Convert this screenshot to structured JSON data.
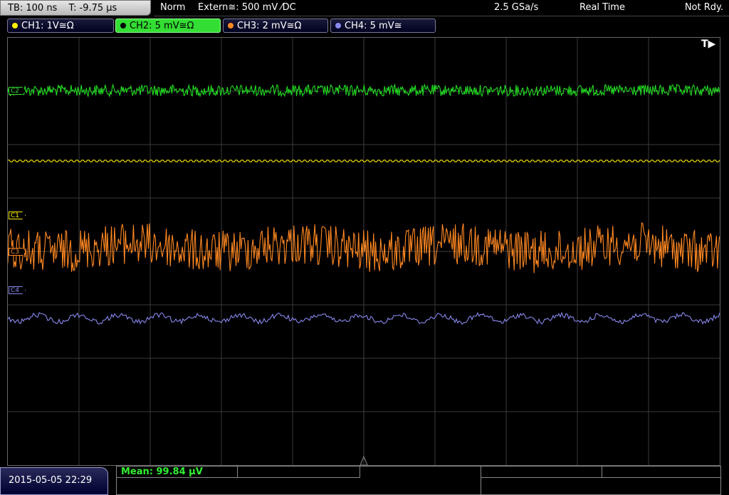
{
  "header": {
    "timebase": "TB: 100 ns",
    "trigger_time": "T: -9.75 µs",
    "mode": "Norm",
    "trigger_source": "Extern≅: 500 mV ⁄DC",
    "sample_rate": "2.5 GSa/s",
    "acquisition": "Real Time",
    "status": "Not Rdy."
  },
  "channels": [
    {
      "label": "CH1: 1V≅Ω",
      "color": "#ffee00",
      "active": false
    },
    {
      "label": "CH2: 5 mV≅Ω",
      "color": "#33dd33",
      "active": true
    },
    {
      "label": "CH3: 2 mV≅Ω",
      "color": "#ff8822",
      "active": false
    },
    {
      "label": "CH4: 5 mV≅",
      "color": "#8888ee",
      "active": false
    }
  ],
  "markers": {
    "c2": "C2",
    "c1": "C1",
    "c3": "C3",
    "c4": "C4",
    "trigger_position": "T▶"
  },
  "footer": {
    "datetime": "2015-05-05 22:29",
    "measurement": "Mean: 99.84 µV"
  }
}
